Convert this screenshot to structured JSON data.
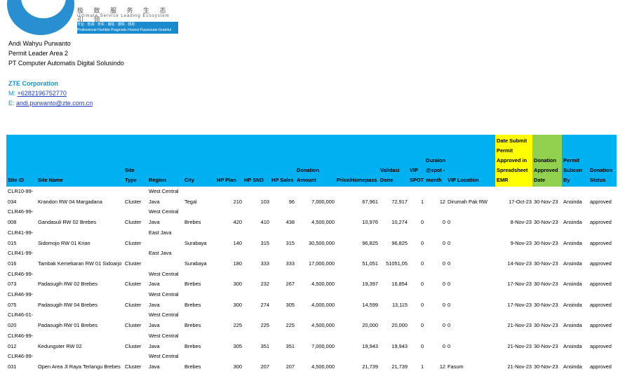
{
  "logo": {
    "line1": "极 致 服 务   生 态 引 领",
    "line2": "Ultimate Service   Leading Ecosystem",
    "banner": "专业 · 低调 · 务实 · 诚信 · 激情 · 感恩 Professional·Humble·Pragmatic·Honest·Passionate·Grateful"
  },
  "signature": {
    "name": "Andi Wahyu Purwanto",
    "role": "Permit Leader Area 2",
    "company_local": "PT Computer Automatis Digital Solusindo",
    "company": "ZTE Corporation",
    "mobile_label": "M: ",
    "mobile": "+6282196752770",
    "email_label": "E: ",
    "email": "andi.purwanto@zte.com.cn"
  },
  "table": {
    "headers": [
      "Site ID",
      "Site Name",
      "Site Type",
      "Region",
      "City",
      "HP Plan",
      "HP SND",
      "HP Sales",
      "Donation Amount",
      "Price/Homepass",
      "Validasi Done",
      "VIP SPOT",
      "Duraion @spot - month",
      "VIP Location",
      "Date Submit Permit Approved in Spreadsheet EMR",
      "Donation Approved Date",
      "Permit Subcon By",
      "Donation Status"
    ],
    "rows": [
      [
        "CLR10-99-034",
        "Krandon RW 04 Margadana",
        "Cluster",
        "West Central Java",
        "Tegal",
        "210",
        "103",
        "96",
        "7,000,000",
        "67,961",
        "72,917",
        "1",
        "12",
        "Dirumah Pak RW",
        "17-Oct-23",
        "30-Nov-23",
        "Ansinda",
        "approved"
      ],
      [
        "CLR46-99-008",
        "Gandasuli RW 02 Brebes",
        "Cluster",
        "West Central Java",
        "Brebes",
        "420",
        "410",
        "438",
        "4,500,000",
        "10,976",
        "10,274",
        "0",
        "0",
        "0",
        "8-Nov-23",
        "30-Nov-23",
        "Ansinda",
        "approved"
      ],
      [
        "CLR41-99-015",
        "Sidomojo RW 01 Krian",
        "Cluster",
        "East Java",
        "Surabaya",
        "140",
        "315",
        "315",
        "30,500,000",
        "96,825",
        "96,825",
        "0",
        "0",
        "0",
        "9-Nov-23",
        "30-Nov-23",
        "Ansinda",
        "approved"
      ],
      [
        "CLR41-99-016",
        "Tambak Kemekaran RW 01 Sidoarjo",
        "Cluster",
        "East Java",
        "Surabaya",
        "180",
        "333",
        "333",
        "17,000,000",
        "51,051",
        "51051,05",
        "0",
        "0",
        "0",
        "14-Nov-23",
        "30-Nov-23",
        "Ansinda",
        "approved"
      ],
      [
        "CLR46-99-073",
        "Padasugih RW 02 Brebes",
        "Cluster",
        "West Central Java",
        "Brebes",
        "300",
        "232",
        "267",
        "4,500,000",
        "19,397",
        "16,854",
        "0",
        "0",
        "0",
        "17-Nov-23",
        "30-Nov-23",
        "Ansinda",
        "approved"
      ],
      [
        "CLR46-99-075",
        "Padasugih RW 04 Brebes",
        "Cluster",
        "West Central Java",
        "Brebes",
        "300",
        "274",
        "305",
        "4,000,000",
        "14,599",
        "13,115",
        "0",
        "0",
        "0",
        "17-Nov-23",
        "30-Nov-23",
        "Ansinda",
        "approved"
      ],
      [
        "CLR46-01-020",
        "Padasugih RW 01 Brebes",
        "Cluster",
        "West Central Java",
        "Brebes",
        "225",
        "225",
        "225",
        "4,500,000",
        "20,000",
        "20,000",
        "0",
        "0",
        "0",
        "21-Nov-23",
        "30-Nov-23",
        "Ansinda",
        "approved"
      ],
      [
        "CLR46-99-012",
        "Kedunguter RW 02",
        "Cluster",
        "West Central Java",
        "Brebes",
        "305",
        "351",
        "351",
        "7,000,000",
        "19,943",
        "19,943",
        "0",
        "0",
        "0",
        "21-Nov-23",
        "30-Nov-23",
        "Ansinda",
        "approved"
      ],
      [
        "CLR46-99-031",
        "Open Area Jl Raya Terlangu Brebes",
        "Cluster",
        "West Central Java",
        "Brebes",
        "300",
        "207",
        "207",
        "4,500,000",
        "21,739",
        "21,739",
        "1",
        "12",
        "Fasum",
        "21-Nov-23",
        "30-Nov-23",
        "Ansinda",
        "approved"
      ]
    ]
  }
}
